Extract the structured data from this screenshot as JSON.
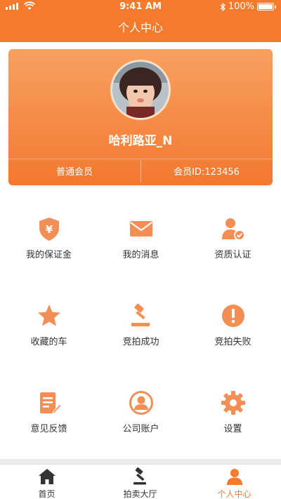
{
  "status_bar": {
    "time": "9:41 AM",
    "battery": "100%"
  },
  "header": {
    "title": "个人中心"
  },
  "profile": {
    "username": "哈利路亚_N",
    "member_level": "普通会员",
    "member_id": "会员ID:123456"
  },
  "menu": {
    "items": [
      {
        "label": "我的保证金",
        "icon": "shield-yen-icon"
      },
      {
        "label": "我的消息",
        "icon": "envelope-icon"
      },
      {
        "label": "资质认证",
        "icon": "user-check-icon"
      },
      {
        "label": "收藏的车",
        "icon": "star-icon"
      },
      {
        "label": "竞拍成功",
        "icon": "gavel-icon"
      },
      {
        "label": "竞拍失败",
        "icon": "exclamation-circle-icon"
      },
      {
        "label": "意见反馈",
        "icon": "edit-note-icon"
      },
      {
        "label": "公司账户",
        "icon": "user-circle-icon"
      },
      {
        "label": "设置",
        "icon": "gear-icon"
      }
    ]
  },
  "tab_bar": {
    "tabs": [
      {
        "label": "首页",
        "icon": "home-icon",
        "active": false
      },
      {
        "label": "拍卖大厅",
        "icon": "gavel-icon",
        "active": false
      },
      {
        "label": "个人中心",
        "icon": "person-icon",
        "active": true
      }
    ]
  },
  "colors": {
    "accent": "#f57a2b",
    "icon": "#f38f55",
    "tab_icon": "#333333"
  }
}
